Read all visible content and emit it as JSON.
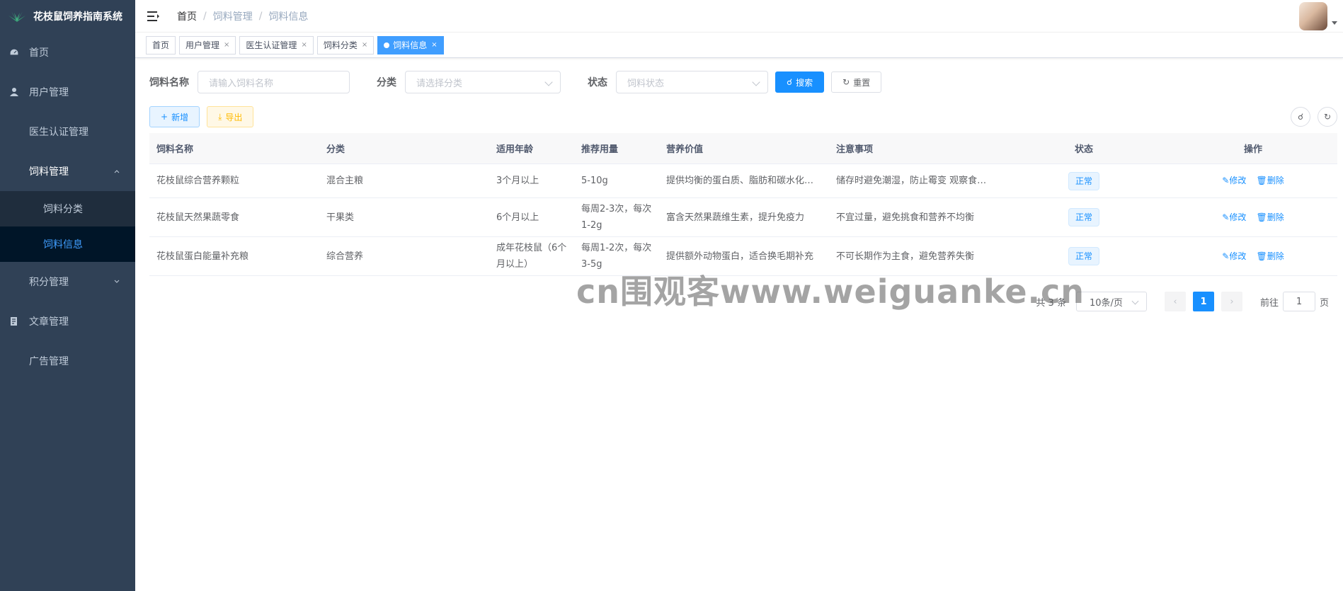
{
  "app": {
    "title": "花枝鼠饲养指南系统"
  },
  "sidebar": {
    "items": [
      {
        "label": "首页"
      },
      {
        "label": "用户管理"
      },
      {
        "label": "医生认证管理"
      },
      {
        "label": "饲料管理"
      },
      {
        "label": "饲料分类"
      },
      {
        "label": "饲料信息"
      },
      {
        "label": "积分管理"
      },
      {
        "label": "文章管理"
      },
      {
        "label": "广告管理"
      }
    ]
  },
  "breadcrumb": {
    "home": "首页",
    "sep": "/",
    "parent": "饲料管理",
    "current": "饲料信息"
  },
  "tags": [
    {
      "label": "首页"
    },
    {
      "label": "用户管理",
      "close": "×"
    },
    {
      "label": "医生认证管理",
      "close": "×"
    },
    {
      "label": "饲料分类",
      "close": "×"
    },
    {
      "label": "饲料信息",
      "close": "×"
    }
  ],
  "search": {
    "name_label": "饲料名称",
    "name_placeholder": "请输入饲料名称",
    "category_label": "分类",
    "category_placeholder": "请选择分类",
    "status_label": "状态",
    "status_placeholder": "饲料状态",
    "search_btn": "搜索",
    "reset_btn": "重置"
  },
  "toolbar": {
    "add": "新增",
    "export": "导出"
  },
  "table": {
    "headers": [
      "饲料名称",
      "分类",
      "适用年龄",
      "推荐用量",
      "营养价值",
      "注意事项",
      "状态",
      "操作"
    ],
    "rows": [
      {
        "name": "花枝鼠综合营养颗粒",
        "category": "混合主粮",
        "age": "3个月以上",
        "dose": "5-10g",
        "nutrition": "提供均衡的蛋白质、脂肪和碳水化合物",
        "notes": "储存时避免潮湿，防止霉变 观察食用情况",
        "status": "正常",
        "edit": "修改",
        "del": "删除"
      },
      {
        "name": "花枝鼠天然果蔬零食",
        "category": "干果类",
        "age": "6个月以上",
        "dose": "每周2-3次，每次1-2g",
        "nutrition": "富含天然果蔬维生素，提升免疫力",
        "notes": "不宜过量，避免挑食和营养不均衡",
        "status": "正常",
        "edit": "修改",
        "del": "删除"
      },
      {
        "name": "花枝鼠蛋白能量补充粮",
        "category": "综合营养",
        "age": "成年花枝鼠（6个月以上）",
        "dose": "每周1-2次，每次3-5g",
        "nutrition": "提供额外动物蛋白，适合换毛期补充",
        "notes": "不可长期作为主食，避免营养失衡",
        "status": "正常",
        "edit": "修改",
        "del": "删除"
      }
    ]
  },
  "pagination": {
    "total": "共 3 条",
    "page_size": "10条/页",
    "current_page": "1",
    "goto": "前往",
    "goto_value": "1",
    "page_unit": "页"
  },
  "watermark": "cn围观客www.weiguanke.cn",
  "colors": {
    "sidebar": "#304156",
    "primary": "#1890ff",
    "active_menu_bg": "#001528"
  }
}
